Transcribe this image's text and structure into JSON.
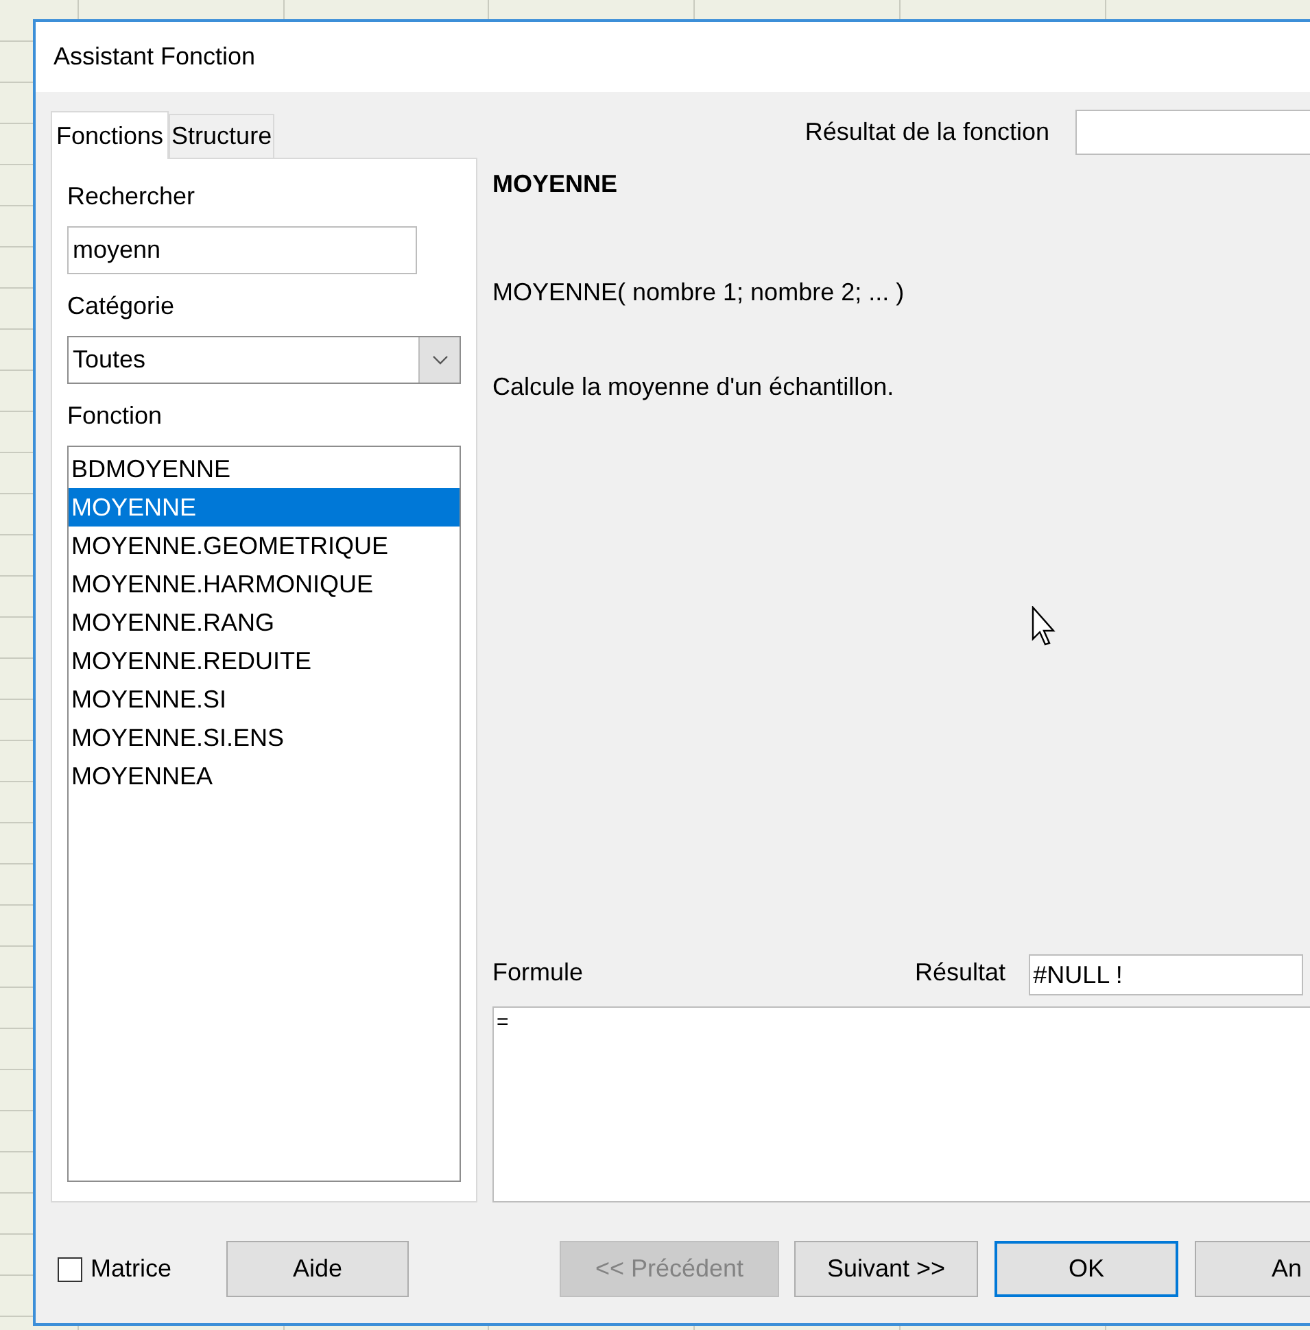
{
  "window": {
    "title": "Assistant Fonction"
  },
  "tabs": [
    {
      "label": "Fonctions",
      "selected": true
    },
    {
      "label": "Structure",
      "selected": false
    }
  ],
  "search": {
    "label": "Rechercher",
    "value": "moyenn"
  },
  "category": {
    "label": "Catégorie",
    "value": "Toutes"
  },
  "functions": {
    "label": "Fonction",
    "items": [
      {
        "label": "BDMOYENNE",
        "selected": false
      },
      {
        "label": "MOYENNE",
        "selected": true
      },
      {
        "label": "MOYENNE.GEOMETRIQUE",
        "selected": false
      },
      {
        "label": "MOYENNE.HARMONIQUE",
        "selected": false
      },
      {
        "label": "MOYENNE.RANG",
        "selected": false
      },
      {
        "label": "MOYENNE.REDUITE",
        "selected": false
      },
      {
        "label": "MOYENNE.SI",
        "selected": false
      },
      {
        "label": "MOYENNE.SI.ENS",
        "selected": false
      },
      {
        "label": "MOYENNEA",
        "selected": false
      }
    ]
  },
  "function_result": {
    "label": "Résultat de la fonction"
  },
  "details": {
    "name": "MOYENNE",
    "syntax": "MOYENNE( nombre 1; nombre 2; ...  )",
    "description": "Calcule la moyenne d'un échantillon."
  },
  "formula": {
    "label": "Formule",
    "value": "=",
    "result_label": "Résultat",
    "result_value": "#NULL !"
  },
  "array": {
    "label": "Matrice",
    "checked": false
  },
  "buttons": [
    {
      "label": "Aide",
      "disabled": false,
      "default": false
    },
    {
      "label": "<< Précédent",
      "disabled": true,
      "default": false
    },
    {
      "label": "Suivant >>",
      "disabled": false,
      "default": false
    },
    {
      "label": "OK",
      "disabled": false,
      "default": true
    },
    {
      "label": "An",
      "disabled": false,
      "default": false
    }
  ]
}
